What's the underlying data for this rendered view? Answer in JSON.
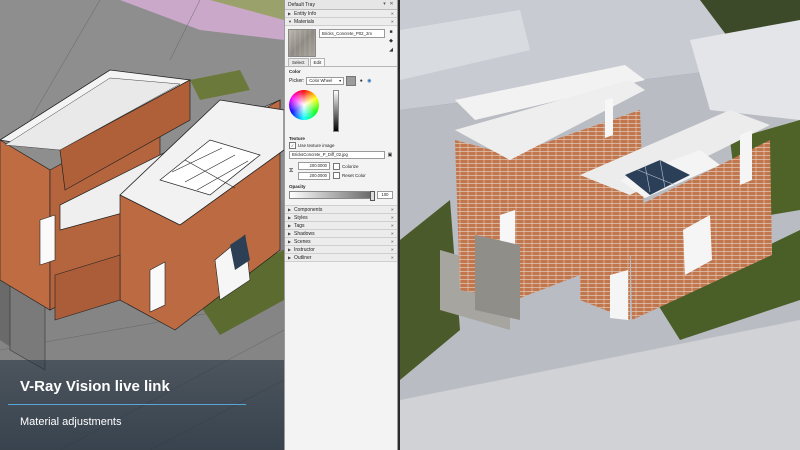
{
  "tray": {
    "title": "Default Tray",
    "entity_info": "Entity Info",
    "materials": "Materials",
    "material_name": "Bricks_Concrete_P02_2m",
    "tabs": [
      "Select",
      "Edit"
    ],
    "color_label": "Color",
    "picker_label": "Picker:",
    "picker_value": "Color Wheel",
    "texture_label": "Texture",
    "use_texture": "Use texture image",
    "texture_file": "BricksConcrete_P_Diff_02.jpg",
    "width": "200.0000",
    "height": "200.0000",
    "colorize": "Colorize",
    "reset_color": "Reset Color",
    "opacity_label": "Opacity",
    "opacity_value": "100",
    "collapsed_panels": [
      "Components",
      "Styles",
      "Tags",
      "Shadows",
      "Scenes",
      "Instructor",
      "Outliner"
    ]
  },
  "caption": {
    "title": "V-Ray Vision live link",
    "subtitle": "Material adjustments"
  },
  "colors": {
    "brick": "#b5653e",
    "caption_line": "#5aa5d8",
    "grass": "#5c6b2f"
  }
}
